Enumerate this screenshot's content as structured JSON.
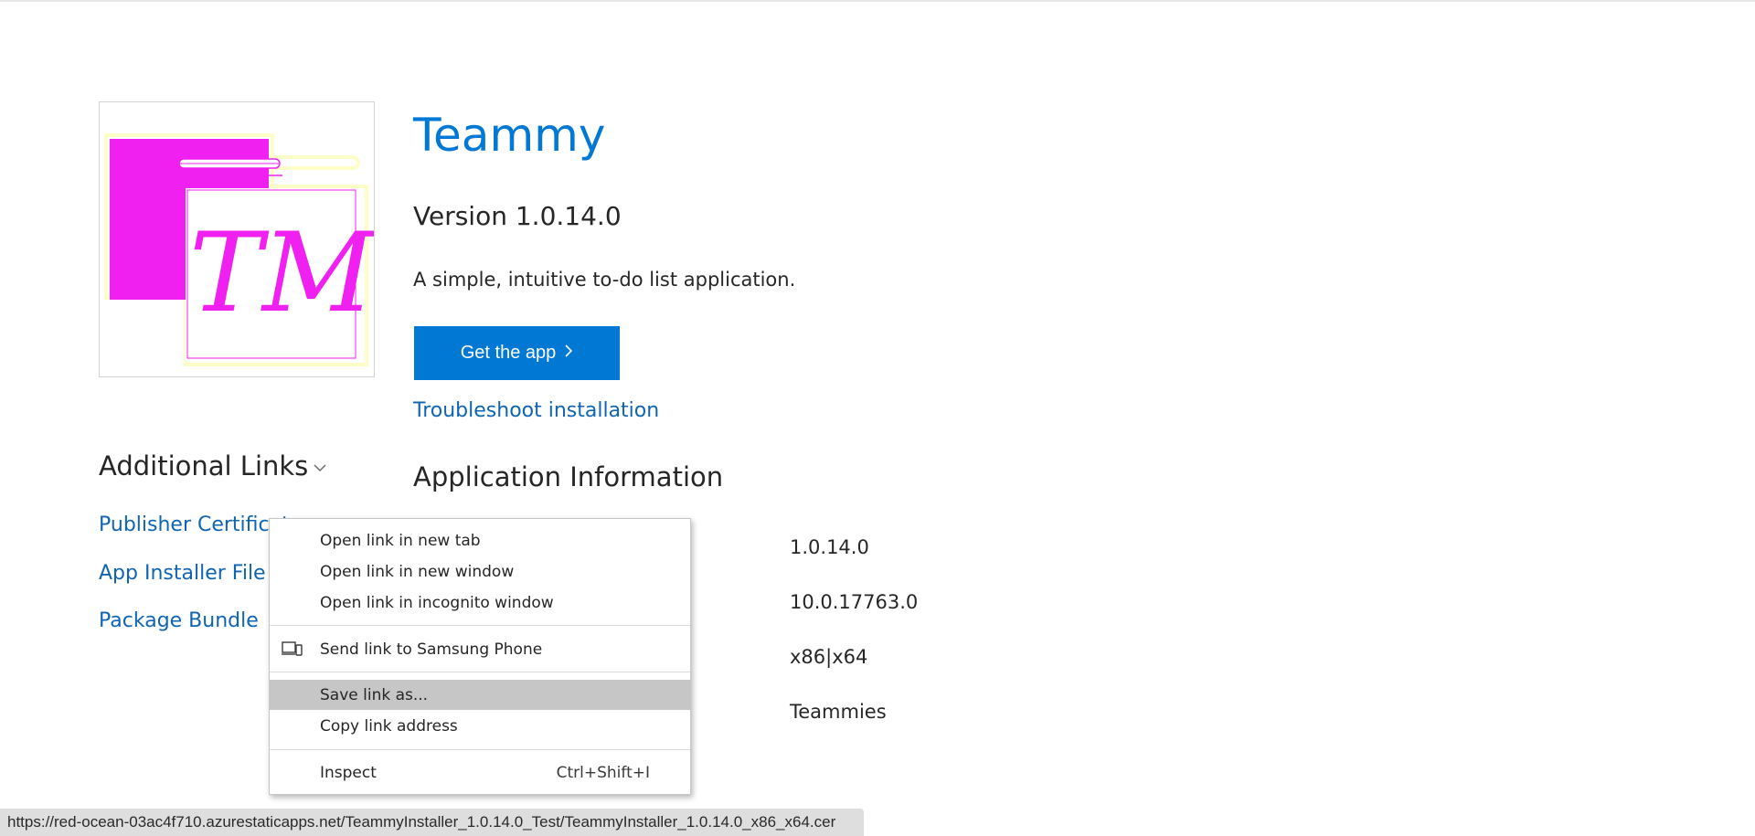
{
  "app": {
    "title": "Teammy",
    "version": "Version 1.0.14.0",
    "description": "A simple, intuitive to-do list application.",
    "logo_text": "TM",
    "get_app_label": "Get the app",
    "troubleshoot_label": "Troubleshoot installation"
  },
  "additional_links": {
    "title": "Additional Links",
    "items": [
      {
        "label": "Publisher Certificat"
      },
      {
        "label": "App Installer File"
      },
      {
        "label": "Package Bundle"
      }
    ]
  },
  "application_information": {
    "title": "Application Information",
    "values": [
      "1.0.14.0",
      "10.0.17763.0",
      "x86|x64",
      "Teammies"
    ]
  },
  "context_menu": {
    "items": [
      {
        "label": "Open link in new tab",
        "shortcut": "",
        "icon": ""
      },
      {
        "label": "Open link in new window",
        "shortcut": "",
        "icon": ""
      },
      {
        "label": "Open link in incognito window",
        "shortcut": "",
        "icon": ""
      },
      {
        "label": "Send link to Samsung Phone",
        "shortcut": "",
        "icon": "devices-icon"
      },
      {
        "label": "Save link as...",
        "shortcut": "",
        "icon": "",
        "highlighted": true
      },
      {
        "label": "Copy link address",
        "shortcut": "",
        "icon": ""
      },
      {
        "label": "Inspect",
        "shortcut": "Ctrl+Shift+I",
        "icon": ""
      }
    ]
  },
  "status_bar": {
    "url": "https://red-ocean-03ac4f710.azurestaticapps.net/TeammyInstaller_1.0.14.0_Test/TeammyInstaller_1.0.14.0_x86_x64.cer"
  },
  "colors": {
    "accent": "#0078d4",
    "link": "#0f65b3",
    "logo_magenta": "#f020f0",
    "logo_outline": "#fdfdc8",
    "menu_highlight": "#c6c6c6"
  }
}
